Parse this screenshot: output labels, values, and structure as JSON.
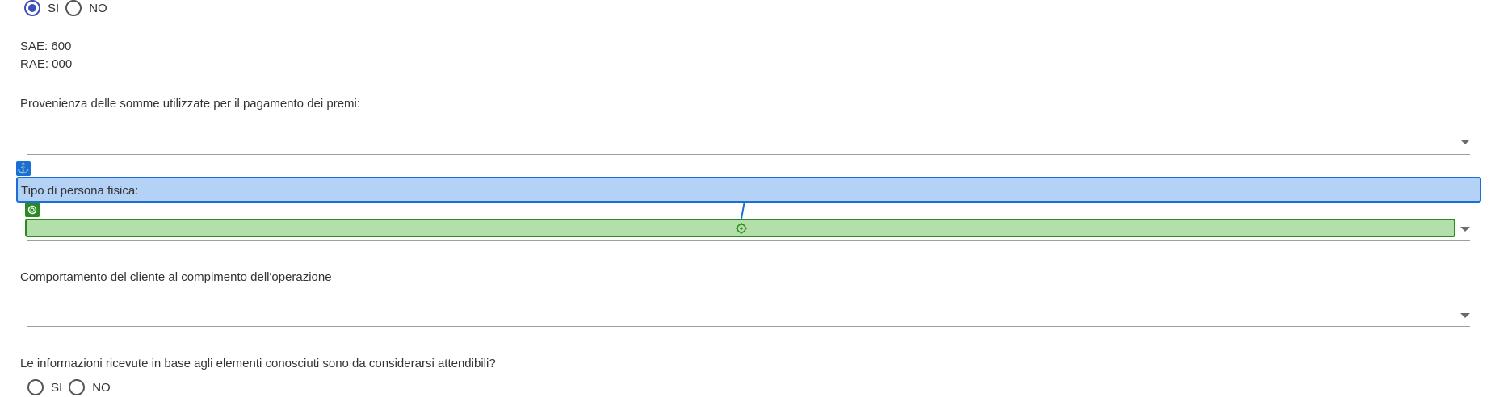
{
  "q_top": {
    "options": [
      "SI",
      "NO"
    ],
    "selected": "SI"
  },
  "codes": {
    "sae": "SAE: 600",
    "rae": "RAE: 000"
  },
  "provenienza": {
    "label": "Provenienza delle somme utilizzate per il pagamento dei premi:",
    "value": ""
  },
  "tipo_persona": {
    "label": "Tipo di persona fisica:",
    "value": ""
  },
  "comportamento": {
    "label": "Comportamento del cliente al compimento dell'operazione",
    "value": ""
  },
  "informazioni": {
    "label": "Le informazioni ricevute in base agli elementi conosciuti sono da considerarsi attendibili?",
    "options": [
      "SI",
      "NO"
    ],
    "selected": null
  },
  "colors": {
    "anchor": "#1a6fd6",
    "anchor_fill": "#b3d2f5",
    "target": "#2a8a1f",
    "target_fill": "#b3dfaa",
    "radio_accent": "#3f51b5"
  }
}
